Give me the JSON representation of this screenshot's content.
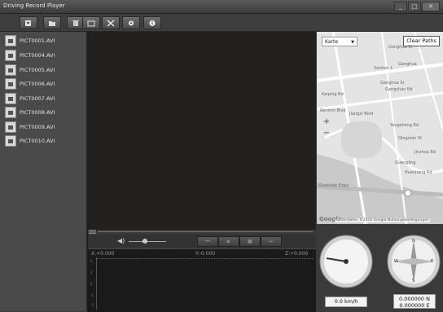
{
  "window": {
    "title": "Driving Record Player",
    "minimize": "_",
    "maximize": "□",
    "close": "✕"
  },
  "toolbar": {
    "buttons": [
      {
        "name": "open-file-button",
        "icon": "open-file-icon"
      },
      {
        "name": "open-folder-button",
        "icon": "folder-icon"
      },
      {
        "name": "delete-button",
        "icon": "trash-icon"
      },
      {
        "name": "snapshot-button",
        "icon": "camera-icon"
      },
      {
        "name": "tools-button",
        "icon": "tools-icon"
      },
      {
        "name": "settings-button",
        "icon": "gear-icon"
      },
      {
        "name": "info-button",
        "icon": "info-icon"
      }
    ]
  },
  "files": [
    "PICT0001.AVI",
    "PICT0004.AVI",
    "PICT0005.AVI",
    "PICT0006.AVI",
    "PICT0007.AVI",
    "PICT0008.AVI",
    "PICT0009.AVI",
    "PICT0010.AVI"
  ],
  "map": {
    "type_select": "Karte",
    "clear_paths": "Clear Paths",
    "zoom_in": "+",
    "zoom_out": "−",
    "logo": "Google",
    "attribution": "Kartendaten ©2016 Google  Nutzungsbedingungen",
    "street_labels": [
      "Ganghua St",
      "Ganghua",
      "Section 1",
      "Ganghua St",
      "Gangshan Rd",
      "Qingnian St",
      "Kaiping Rd",
      "Renmin Blvd",
      "Jiangxi Blvd",
      "Yangsheng Rd",
      "Jinzhou Rd",
      "Riverside Expy",
      "Guangling",
      "Huanjiang Rd"
    ]
  },
  "seek": {
    "tag": "0000"
  },
  "playback": {
    "volume_icon": "◀)",
    "prev": "⏮",
    "play": "▶",
    "stop": "■",
    "next": "⏭"
  },
  "graph": {
    "x_label": "X:+0.000",
    "y_label": "Y:-0.000",
    "z_label": "Z:+0.000",
    "ticks": [
      "2",
      "1",
      "0",
      "-1",
      "-2"
    ]
  },
  "speed": {
    "readout": "0.0 km/h"
  },
  "compass": {
    "lat": "0.000000 N",
    "lon": "0.000000 E",
    "north": "N",
    "south": "S",
    "west": "W",
    "east": "E"
  }
}
